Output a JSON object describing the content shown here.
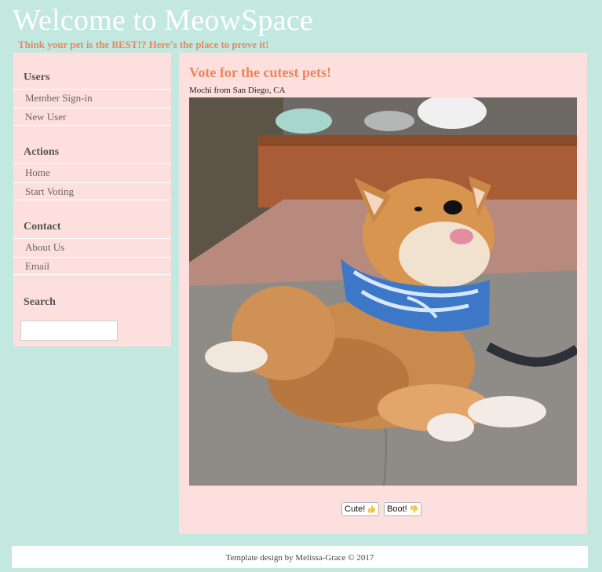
{
  "site": {
    "title": "Welcome to MeowSpace",
    "tagline": "Think your pet is the BEST!? Here's the place to prove it!"
  },
  "sidebar": {
    "sections": [
      {
        "heading": "Users",
        "items": [
          {
            "label": "Member Sign-in"
          },
          {
            "label": "New User"
          }
        ]
      },
      {
        "heading": "Actions",
        "items": [
          {
            "label": "Home"
          },
          {
            "label": "Start Voting"
          }
        ]
      },
      {
        "heading": "Contact",
        "items": [
          {
            "label": "About Us"
          },
          {
            "label": "Email"
          }
        ]
      },
      {
        "heading": "Search",
        "items": []
      }
    ],
    "search_value": ""
  },
  "main": {
    "heading": "Vote for the cutest pets!",
    "caption": "Mochi from San Diego, CA",
    "buttons": {
      "cute_label": "Cute!",
      "boot_label": "Boot!"
    }
  },
  "icons": {
    "cute": "thumbs-up-icon",
    "boot": "thumbs-down-icon"
  },
  "colors": {
    "background": "#c2e8df",
    "panel": "#fde0dd",
    "accent": "#e8875f",
    "title": "#ffffff"
  },
  "footer": {
    "text": "Template design by Melissa-Grace © 2017"
  }
}
